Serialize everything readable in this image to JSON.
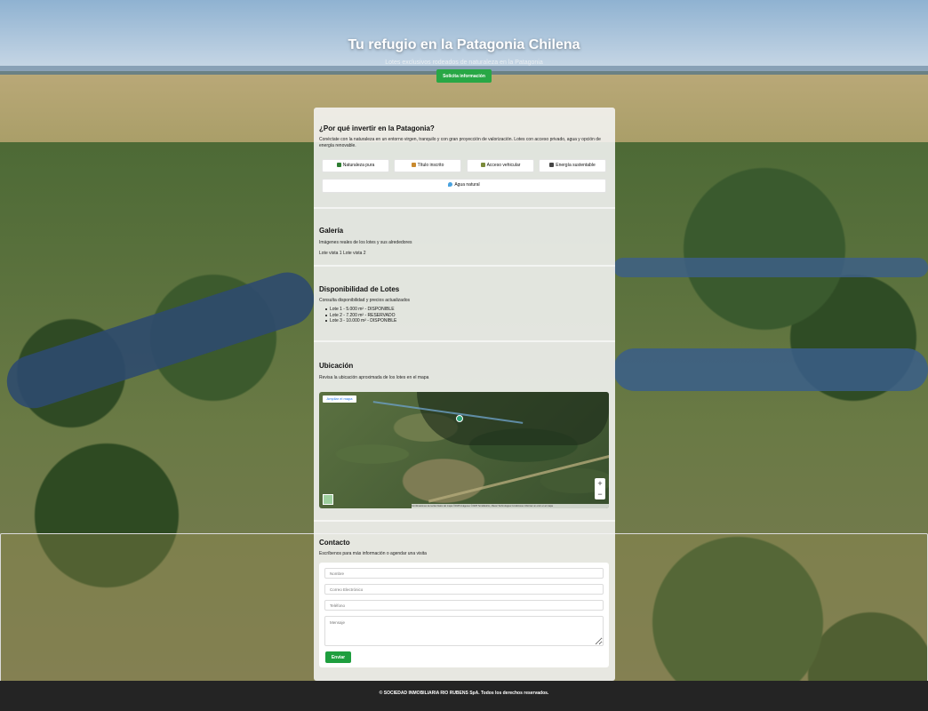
{
  "hero": {
    "title": "Tu refugio en la Patagonia Chilena",
    "subtitle": "Lotes exclusivos rodeados de naturaleza en la Patagonia",
    "cta_label": "Solicita información",
    "cta_color": "#28a745"
  },
  "why": {
    "title": "¿Por qué invertir en la Patagonia?",
    "text": "Conéctate con la naturaleza en un entorno virgen, tranquilo y con gran proyección de valorización. Lotes con acceso privado, agua y opción de energía renovable.",
    "features": [
      {
        "label": "Naturaleza pura",
        "icon": "tree-icon"
      },
      {
        "label": "Título inscrito",
        "icon": "document-icon"
      },
      {
        "label": "Acceso vehicular",
        "icon": "car-icon"
      },
      {
        "label": "Energía sustentable",
        "icon": "plug-icon"
      },
      {
        "label": "Agua natural",
        "icon": "water-drop-icon"
      }
    ]
  },
  "gallery": {
    "title": "Galería",
    "text": "Imágenes reales de los lotes y sus alrededores",
    "images_alt": "Lote vista 1 Lote vista 2"
  },
  "availability": {
    "title": "Disponibilidad de Lotes",
    "text": "Consulta disponibilidad y precios actualizados",
    "lots": [
      "Lote 1 - 5.000 m² - DISPONIBLE",
      "Lote 2 - 7.200 m² - RESERVADO",
      "Lote 3 - 10.000 m² - DISPONIBLE"
    ]
  },
  "location": {
    "title": "Ubicación",
    "text": "Revisa la ubicación aproximada de los lotes en el mapa",
    "map_link": "Ampliar el mapa",
    "zoom_in": "+",
    "zoom_out": "−",
    "attribution": "Combinaciones de teclas   Datos del mapa ©2025 Imágenes ©2025 TerraMetrics, Maxar Technologies   Condiciones   Informar un error en el mapa"
  },
  "contact": {
    "title": "Contacto",
    "text": "Escríbenos para más información o agendar una visita",
    "name_placeholder": "Nombre",
    "email_placeholder": "Correo Electrónico",
    "phone_placeholder": "Teléfono",
    "message_placeholder": "Mensaje",
    "submit_label": "Enviar",
    "submit_color": "#1e9e3e"
  },
  "footer": {
    "text": "© SOCIEDAD INMOBILIARIA RIO RUBENS SpA. Todos los derechos reservados."
  }
}
